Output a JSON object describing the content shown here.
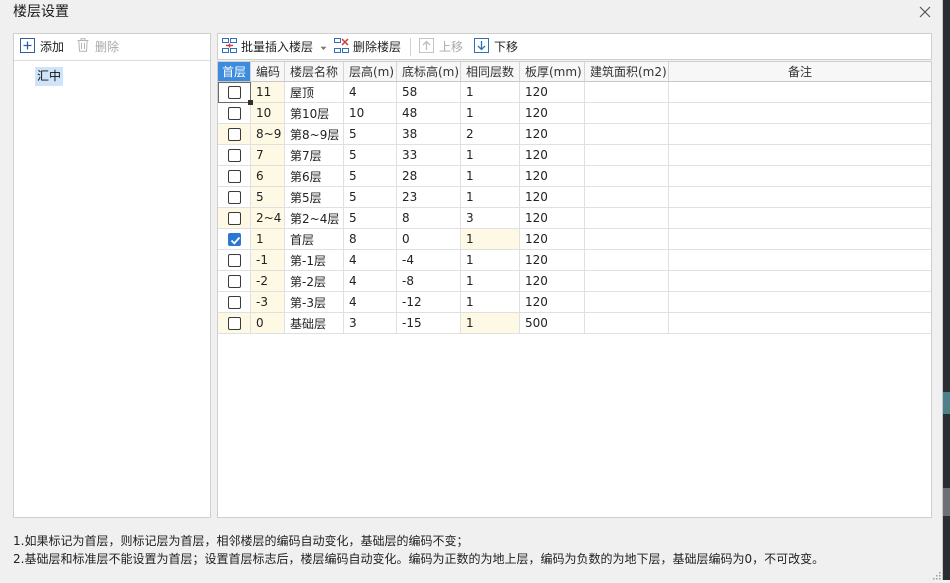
{
  "window": {
    "title": "楼层设置",
    "close_icon": "close-icon"
  },
  "left_panel": {
    "toolbar": {
      "add": {
        "label": "添加",
        "icon": "plus-square-icon",
        "enabled": true
      },
      "delete": {
        "label": "删除",
        "icon": "trash-icon",
        "enabled": false
      }
    },
    "tree": {
      "items": [
        {
          "label": "汇中",
          "selected": true
        }
      ]
    }
  },
  "right_panel": {
    "toolbar": {
      "batch_insert": {
        "label": "批量插入楼层",
        "icon": "batch-insert-icon",
        "dropdown_icon": "chevron-down-icon",
        "enabled": true
      },
      "delete_floor": {
        "label": "删除楼层",
        "icon": "delete-floor-icon",
        "enabled": true
      },
      "move_up": {
        "label": "上移",
        "icon": "arrow-up-icon",
        "enabled": false
      },
      "move_down": {
        "label": "下移",
        "icon": "arrow-down-icon",
        "enabled": true
      }
    }
  },
  "table": {
    "columns": [
      "首层",
      "编码",
      "楼层名称",
      "层高(m)",
      "底标高(m)",
      "相同层数",
      "板厚(mm)",
      "建筑面积(m2)",
      "备注"
    ],
    "code_locked": true,
    "focused_cell": {
      "row": 0,
      "column": 0
    },
    "rows": [
      {
        "first_floor": false,
        "first_floor_locked": false,
        "code": "11",
        "name": "屋顶",
        "height": 4,
        "bottom_elevation": 58,
        "same_floor_count": 1,
        "count_locked": false,
        "slab_thickness": 120,
        "building_area": "",
        "remarks": ""
      },
      {
        "first_floor": false,
        "first_floor_locked": false,
        "code": "10",
        "name": "第10层",
        "height": 10,
        "bottom_elevation": 48,
        "same_floor_count": 1,
        "count_locked": false,
        "slab_thickness": 120,
        "building_area": "",
        "remarks": ""
      },
      {
        "first_floor": false,
        "first_floor_locked": true,
        "code": "8~9",
        "name": "第8~9层",
        "height": 5,
        "bottom_elevation": 38,
        "same_floor_count": 2,
        "count_locked": false,
        "slab_thickness": 120,
        "building_area": "",
        "remarks": ""
      },
      {
        "first_floor": false,
        "first_floor_locked": false,
        "code": "7",
        "name": "第7层",
        "height": 5,
        "bottom_elevation": 33,
        "same_floor_count": 1,
        "count_locked": false,
        "slab_thickness": 120,
        "building_area": "",
        "remarks": ""
      },
      {
        "first_floor": false,
        "first_floor_locked": false,
        "code": "6",
        "name": "第6层",
        "height": 5,
        "bottom_elevation": 28,
        "same_floor_count": 1,
        "count_locked": false,
        "slab_thickness": 120,
        "building_area": "",
        "remarks": ""
      },
      {
        "first_floor": false,
        "first_floor_locked": false,
        "code": "5",
        "name": "第5层",
        "height": 5,
        "bottom_elevation": 23,
        "same_floor_count": 1,
        "count_locked": false,
        "slab_thickness": 120,
        "building_area": "",
        "remarks": ""
      },
      {
        "first_floor": false,
        "first_floor_locked": true,
        "code": "2~4",
        "name": "第2~4层",
        "height": 5,
        "bottom_elevation": 8,
        "same_floor_count": 3,
        "count_locked": false,
        "slab_thickness": 120,
        "building_area": "",
        "remarks": ""
      },
      {
        "first_floor": true,
        "first_floor_locked": false,
        "code": "1",
        "name": "首层",
        "height": 8,
        "bottom_elevation": 0,
        "same_floor_count": 1,
        "count_locked": true,
        "slab_thickness": 120,
        "building_area": "",
        "remarks": ""
      },
      {
        "first_floor": false,
        "first_floor_locked": false,
        "code": "-1",
        "name": "第-1层",
        "height": 4,
        "bottom_elevation": -4,
        "same_floor_count": 1,
        "count_locked": false,
        "slab_thickness": 120,
        "building_area": "",
        "remarks": ""
      },
      {
        "first_floor": false,
        "first_floor_locked": false,
        "code": "-2",
        "name": "第-2层",
        "height": 4,
        "bottom_elevation": -8,
        "same_floor_count": 1,
        "count_locked": false,
        "slab_thickness": 120,
        "building_area": "",
        "remarks": ""
      },
      {
        "first_floor": false,
        "first_floor_locked": false,
        "code": "-3",
        "name": "第-3层",
        "height": 4,
        "bottom_elevation": -12,
        "same_floor_count": 1,
        "count_locked": false,
        "slab_thickness": 120,
        "building_area": "",
        "remarks": ""
      },
      {
        "first_floor": false,
        "first_floor_locked": true,
        "code": "0",
        "name": "基础层",
        "height": 3,
        "bottom_elevation": -15,
        "same_floor_count": 1,
        "count_locked": true,
        "slab_thickness": 500,
        "building_area": "",
        "remarks": ""
      }
    ]
  },
  "notes": [
    "1.如果标记为首层，则标记层为首层，相邻楼层的编码自动变化，基础层的编码不变；",
    "2.基础层和标准层不能设置为首层；设置首层标志后，楼层编码自动变化。编码为正数的为地上层，编码为负数的为地下层，基础层编码为0，不可改变。"
  ],
  "colors": {
    "header_accent": "#3d8bdc",
    "readonly_cell": "#fdf9e4",
    "tree_selection": "#cfe4f8",
    "checkbox_checked": "#2b77d1"
  }
}
